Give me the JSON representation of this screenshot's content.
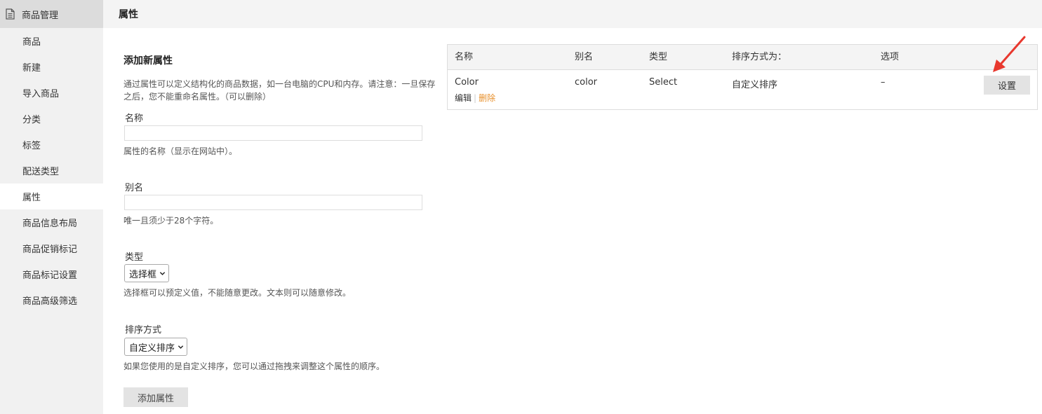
{
  "sidebar": {
    "header": "商品管理",
    "items": [
      {
        "label": "商品"
      },
      {
        "label": "新建"
      },
      {
        "label": "导入商品"
      },
      {
        "label": "分类"
      },
      {
        "label": "标签"
      },
      {
        "label": "配送类型"
      },
      {
        "label": "属性",
        "active": true
      },
      {
        "label": "商品信息布局"
      },
      {
        "label": "商品促销标记"
      },
      {
        "label": "商品标记设置"
      },
      {
        "label": "商品高级筛选"
      }
    ]
  },
  "page": {
    "title": "属性"
  },
  "form": {
    "title": "添加新属性",
    "description": "通过属性可以定义结构化的商品数据，如一台电脑的CPU和内存。请注意：一旦保存之后，您不能重命名属性。（可以删除）",
    "name_label": "名称",
    "name_value": "",
    "name_hint": "属性的名称（显示在网站中）。",
    "slug_label": "别名",
    "slug_value": "",
    "slug_hint": "唯一且须少于28个字符。",
    "type_label": "类型",
    "type_selected": "选择框",
    "type_hint": "选择框可以预定义值，不能随意更改。文本则可以随意修改。",
    "order_label": "排序方式",
    "order_selected": "自定义排序",
    "order_hint": "如果您使用的是自定义排序，您可以通过拖拽来调整这个属性的顺序。",
    "submit_label": "添加属性"
  },
  "table": {
    "headers": {
      "name": "名称",
      "slug": "别名",
      "type": "类型",
      "order": "排序方式为：",
      "options": "选项"
    },
    "rows": [
      {
        "name": "Color",
        "slug": "color",
        "type": "Select",
        "order": "自定义排序",
        "options": "–",
        "edit_label": "编辑",
        "delete_label": "删除",
        "settings_label": "设置"
      }
    ]
  },
  "colors": {
    "sidebar_bg": "#f1f1f1",
    "sidebar_header_bg": "#dcdcdc",
    "delete_link": "#e8912d",
    "arrow": "#e8382e"
  }
}
